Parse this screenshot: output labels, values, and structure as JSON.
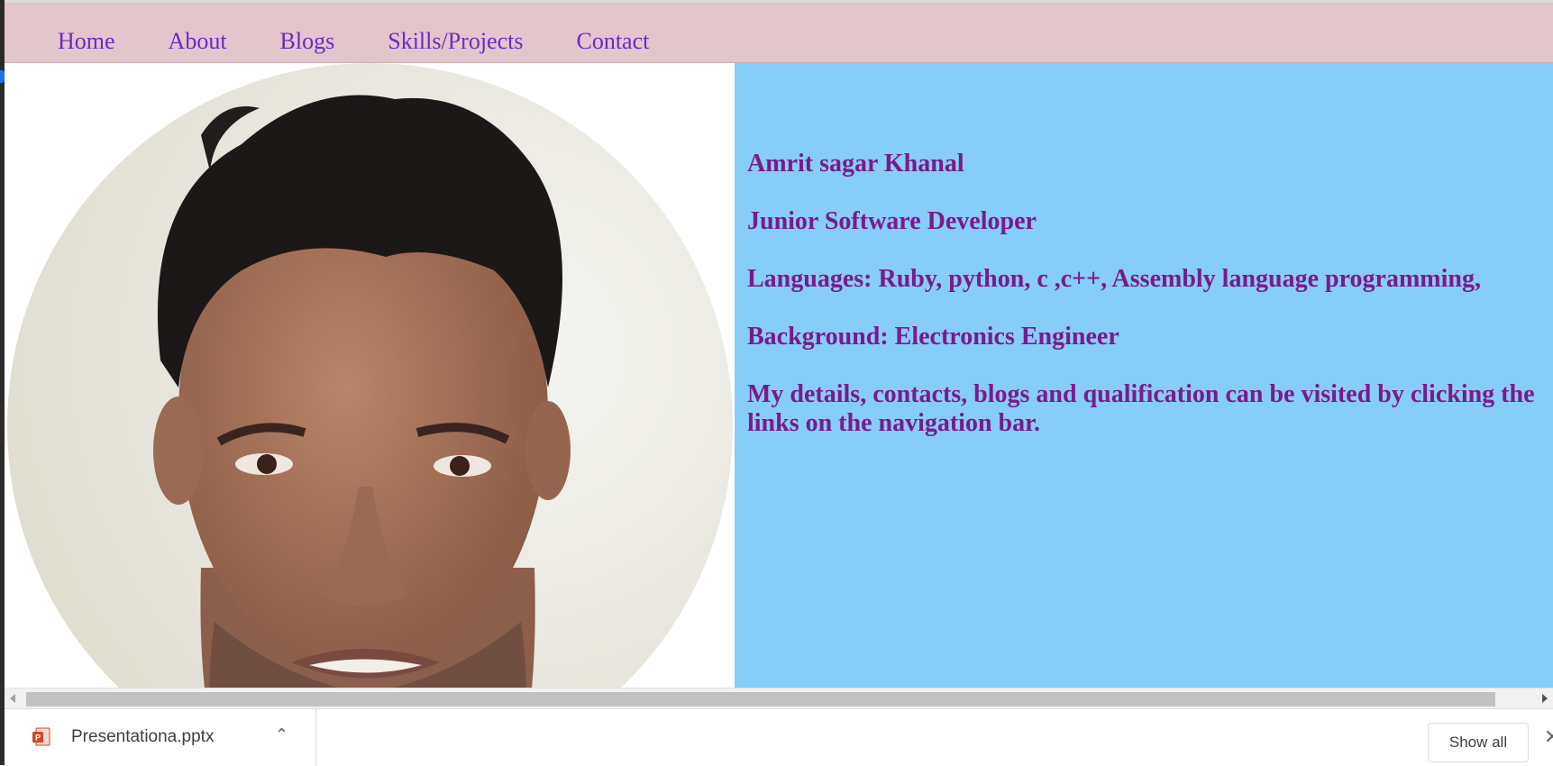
{
  "nav": {
    "items": [
      {
        "label": "Home"
      },
      {
        "label": "About"
      },
      {
        "label": "Blogs"
      },
      {
        "label": "Skills/Projects"
      },
      {
        "label": "Contact"
      }
    ]
  },
  "profile": {
    "name": "Amrit sagar Khanal",
    "role": "Junior Software Developer",
    "languages": "Languages: Ruby, python, c ,c++, Assembly language programming,",
    "background": "Background: Electronics Engineer",
    "details": "My details, contacts, blogs and qualification can be visited by clicking the links on the navigation bar."
  },
  "downloads": {
    "file_name": "Presentationa.pptx",
    "file_icon": "powerpoint-file-icon",
    "show_all_label": "Show all"
  },
  "colors": {
    "nav_bg": "#e3c5cc",
    "nav_link": "#6a2bc4",
    "panel_bg": "#87cdf9",
    "panel_text": "#7a1a8e"
  }
}
